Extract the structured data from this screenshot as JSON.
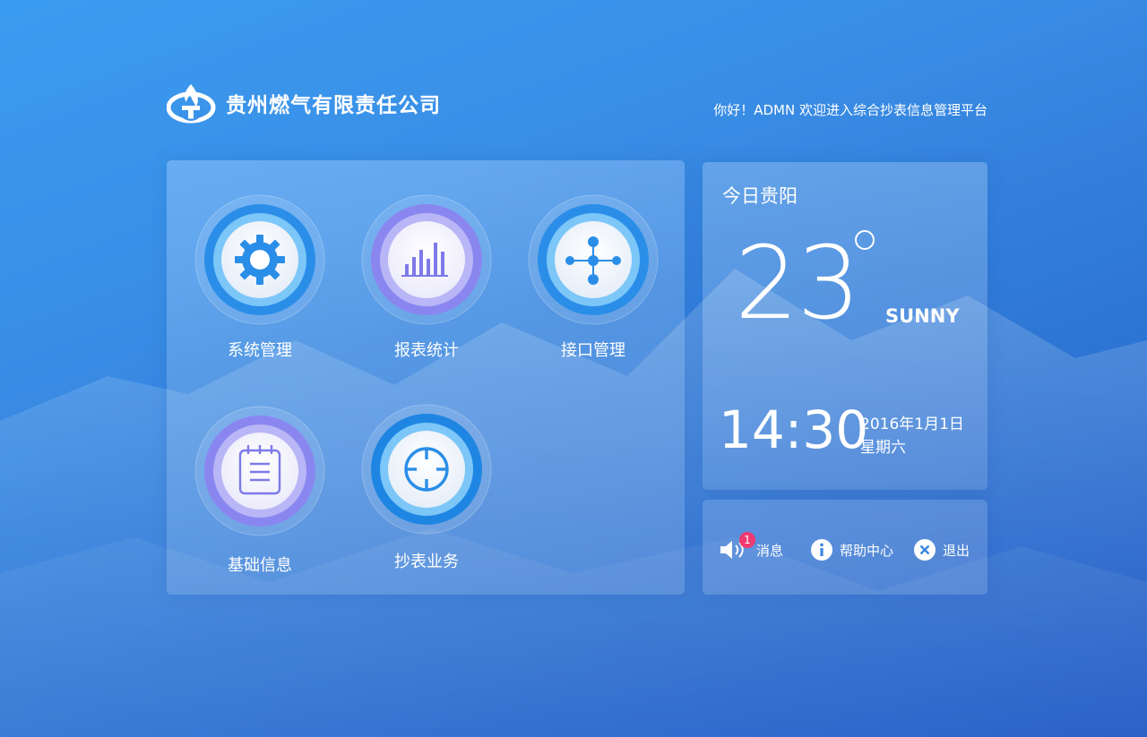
{
  "header": {
    "company_name": "贵州燃气有限责任公司",
    "greeting": "你好！ADMN  欢迎进入综合抄表信息管理平台"
  },
  "menu": {
    "items": [
      {
        "label": "系统管理",
        "icon": "gear-icon"
      },
      {
        "label": "报表统计",
        "icon": "bar-chart-icon"
      },
      {
        "label": "接口管理",
        "icon": "network-icon"
      },
      {
        "label": "基础信息",
        "icon": "notepad-icon"
      },
      {
        "label": "抄表业务",
        "icon": "crosshair-icon"
      }
    ]
  },
  "weather": {
    "city": "今日贵阳",
    "temperature": "23",
    "condition": "SUNNY",
    "time": "14:30",
    "date": "2016年1月1日",
    "weekday": "星期六"
  },
  "actions": {
    "messages_label": "消息",
    "messages_count": "1",
    "help_label": "帮助中心",
    "logout_label": "退出"
  },
  "colors": {
    "blue_ring": "#2a8ee8",
    "purple_ring": "#8a86f0",
    "badge": "#ee3a6f"
  }
}
